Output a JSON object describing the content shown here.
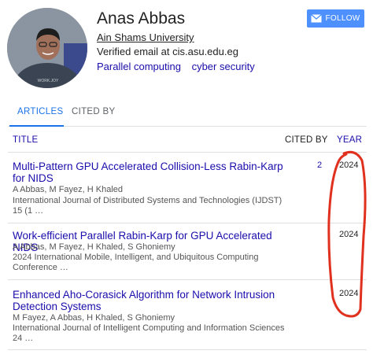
{
  "profile": {
    "name": "Anas Abbas",
    "affiliation": "Ain Shams University",
    "verified": "Verified email at cis.asu.edu.eg",
    "interests": [
      "Parallel computing",
      "cyber security"
    ],
    "follow_label": "FOLLOW",
    "shirt_text": "WORK.JOY"
  },
  "tabs": [
    {
      "label": "ARTICLES",
      "active": true
    },
    {
      "label": "CITED BY",
      "active": false
    }
  ],
  "table": {
    "headers": {
      "title": "TITLE",
      "cited_by": "CITED BY",
      "year": "YEAR"
    },
    "rows": [
      {
        "title": "Multi-Pattern GPU Accelerated Collision-Less Rabin-Karp for NIDS",
        "authors": "A Abbas, M Fayez, H Khaled",
        "venue": "International Journal of Distributed Systems and Technologies (IJDST) 15 (1 …",
        "cited_by": "2",
        "year": "2024"
      },
      {
        "title": "Work-efficient Parallel Rabin-Karp for GPU Accelerated NIDS",
        "authors": "A Abbas, M Fayez, H Khaled, S Ghoniemy",
        "venue": "2024 International Mobile, Intelligent, and Ubiquitous Computing Conference …",
        "cited_by": "",
        "year": "2024"
      },
      {
        "title": "Enhanced Aho-Corasick Algorithm for Network Intrusion Detection Systems",
        "authors": "M Fayez, A Abbas, H Khaled, S Ghoniemy",
        "venue": "International Journal of Intelligent Computing and Information Sciences 24 …",
        "cited_by": "",
        "year": "2024"
      }
    ]
  },
  "colors": {
    "link": "#1a0dab",
    "accent": "#1a73e8",
    "follow_bg": "#4d90fe",
    "annotation": "#e0301e"
  },
  "icons": {
    "follow": "envelope-icon"
  }
}
